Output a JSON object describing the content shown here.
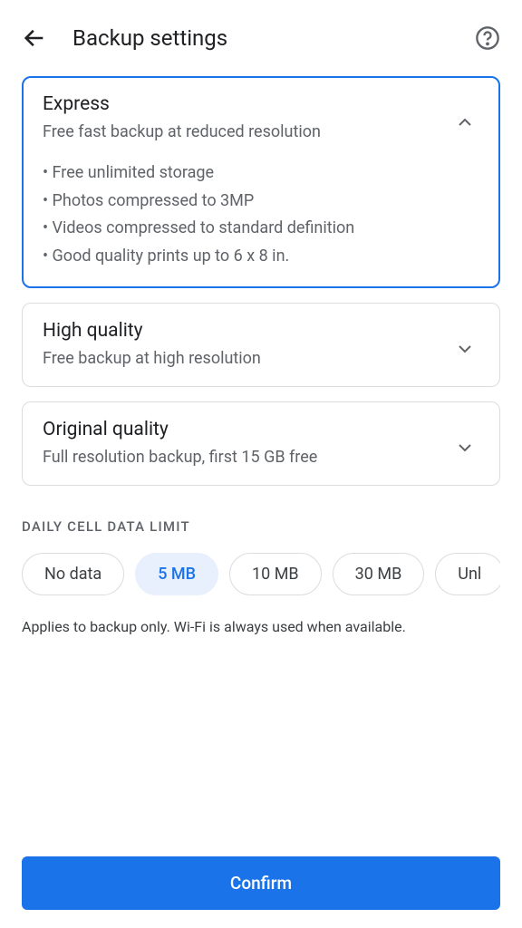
{
  "header": {
    "title": "Backup settings"
  },
  "options": [
    {
      "title": "Express",
      "subtitle": "Free fast backup at reduced resolution",
      "expanded": true,
      "details": [
        "Free unlimited storage",
        "Photos compressed to 3MP",
        "Videos compressed to standard definition",
        "Good quality prints up to 6 x 8 in."
      ]
    },
    {
      "title": "High quality",
      "subtitle": "Free backup at high resolution",
      "expanded": false
    },
    {
      "title": "Original quality",
      "subtitle": "Full resolution backup, first 15 GB free",
      "expanded": false
    }
  ],
  "dataLimit": {
    "sectionLabel": "DAILY CELL DATA LIMIT",
    "chips": [
      "No data",
      "5 MB",
      "10 MB",
      "30 MB",
      "Unl"
    ],
    "selectedIndex": 1,
    "helperText": "Applies to backup only. Wi-Fi is always used when available."
  },
  "confirmLabel": "Confirm"
}
